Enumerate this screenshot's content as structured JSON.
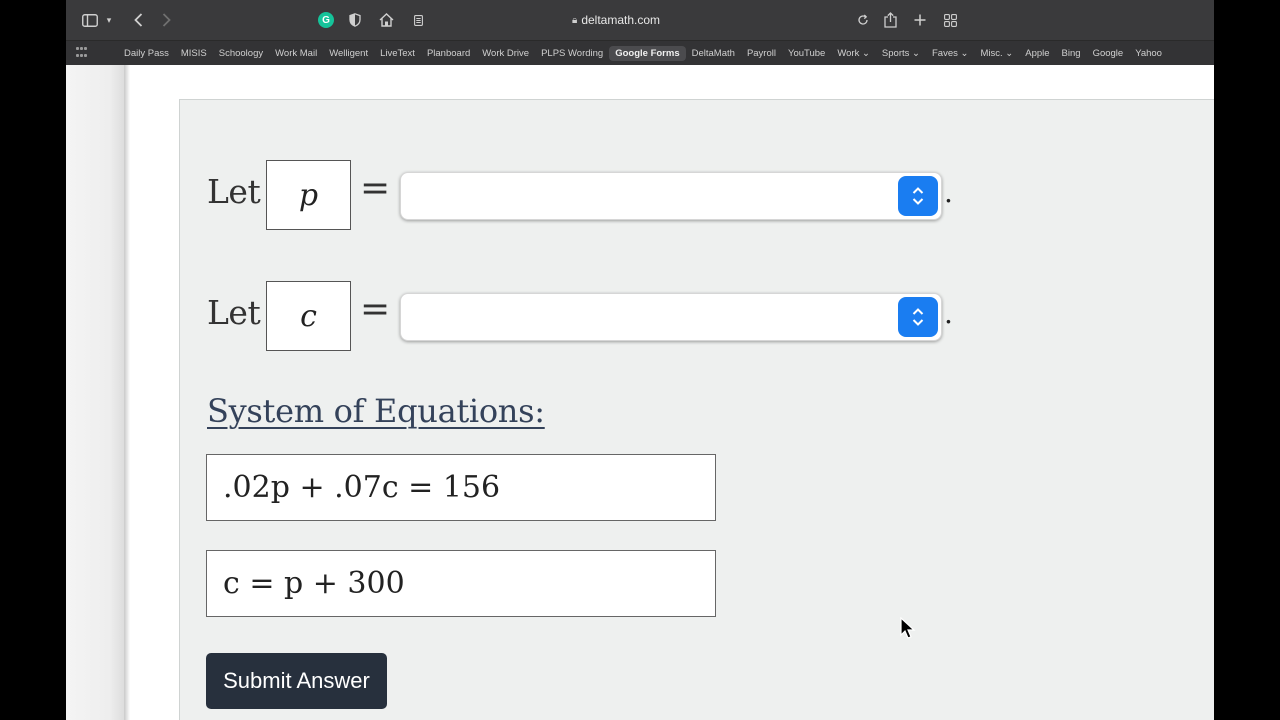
{
  "browser": {
    "address": "deltamath.com",
    "bookmarks": [
      {
        "label": "Daily Pass"
      },
      {
        "label": "MISIS"
      },
      {
        "label": "Schoology"
      },
      {
        "label": "Work Mail"
      },
      {
        "label": "Welligent"
      },
      {
        "label": "LiveText"
      },
      {
        "label": "Planboard"
      },
      {
        "label": "Work Drive"
      },
      {
        "label": "PLPS Wording"
      },
      {
        "label": "Google Forms",
        "active": true
      },
      {
        "label": "DeltaMath"
      },
      {
        "label": "Payroll"
      },
      {
        "label": "YouTube"
      },
      {
        "label": "Work ⌄"
      },
      {
        "label": "Sports ⌄"
      },
      {
        "label": "Faves ⌄"
      },
      {
        "label": "Misc. ⌄"
      },
      {
        "label": "Apple"
      },
      {
        "label": "Bing"
      },
      {
        "label": "Google"
      },
      {
        "label": "Yahoo"
      }
    ],
    "accent_color": "#1a7df1"
  },
  "problem": {
    "let_word": "Let",
    "equals": "=",
    "period": ".",
    "variables": [
      {
        "name": "p",
        "selected": ""
      },
      {
        "name": "c",
        "selected": ""
      }
    ],
    "system_heading": "System of Equations:",
    "equations": [
      ".02p + .07c = 156",
      "c = p + 300"
    ],
    "submit_label": "Submit Answer",
    "submit_color": "#27303d"
  }
}
